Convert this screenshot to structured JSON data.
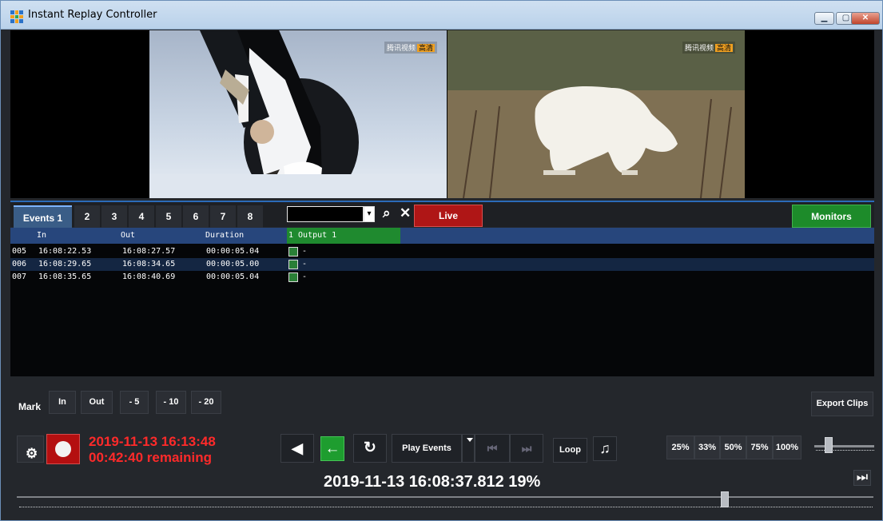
{
  "window": {
    "title": "Instant Replay Controller",
    "minimize_icon": "minimize-icon",
    "restore_icon": "restore-icon",
    "close_icon": "close-icon"
  },
  "video": {
    "left_watermark": "腾讯视频",
    "left_badge": "高清",
    "right_watermark": "腾讯视频",
    "right_badge": "高清"
  },
  "tabs": [
    "Events 1",
    "2",
    "3",
    "4",
    "5",
    "6",
    "7",
    "8"
  ],
  "search": {
    "value": ""
  },
  "toolbar": {
    "live_label": "Live",
    "monitors_label": "Monitors",
    "search_icon": "search-icon",
    "clear_icon": "close-icon"
  },
  "events_table": {
    "headers": [
      "In",
      "Out",
      "Duration",
      "1 Output 1"
    ],
    "rows": [
      {
        "id": "005",
        "in": "16:08:22.53",
        "out": "16:08:27.57",
        "duration": "00:00:05.04",
        "output": "-"
      },
      {
        "id": "006",
        "in": "16:08:29.65",
        "out": "16:08:34.65",
        "duration": "00:00:05.00",
        "output": "-"
      },
      {
        "id": "007",
        "in": "16:08:35.65",
        "out": "16:08:40.69",
        "duration": "00:00:05.04",
        "output": "-"
      }
    ]
  },
  "mark_controls": {
    "label": "Mark",
    "in": "In",
    "out": "Out",
    "minus5": "- 5",
    "minus10": "- 10",
    "minus20": "- 20"
  },
  "export": {
    "label": "Export Clips"
  },
  "status": {
    "datetime": "2019-11-13 16:13:48",
    "remaining": "00:42:40 remaining",
    "position": "2019-11-13 16:08:37.812  19%"
  },
  "playback": {
    "play_events": "Play Events",
    "loop": "Loop",
    "speeds": [
      "25%",
      "33%",
      "50%",
      "75%",
      "100%"
    ],
    "speed_level": 0.2,
    "timeline_level": 0.83
  },
  "colors": {
    "accent_blue": "#2b6bb8",
    "live_red": "#af1616",
    "monitor_green": "#1d8b2a",
    "status_red": "#ff2a2a"
  }
}
